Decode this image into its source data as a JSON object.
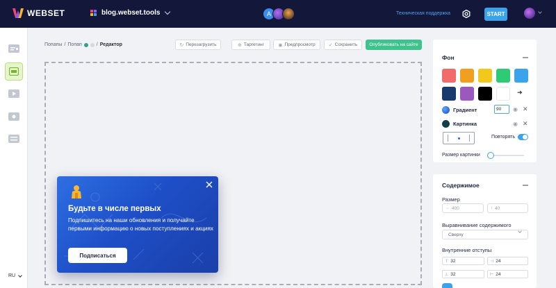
{
  "topbar": {
    "logo_text": "WEBSET",
    "site_name": "blog.webset.tools",
    "support_link": "Техническая поддержка",
    "start_label": "START",
    "avatar_initial": "A"
  },
  "sidebar": {
    "items": [
      {
        "icon": "text-block-icon"
      },
      {
        "icon": "popup-layout-icon",
        "active": true
      },
      {
        "icon": "video-icon"
      },
      {
        "icon": "image-icon"
      },
      {
        "icon": "list-icon"
      }
    ],
    "language": "RU"
  },
  "breadcrumb": {
    "items": [
      "Попапы",
      "Попап"
    ],
    "separator": "/",
    "current": "Редактор"
  },
  "toolbar": {
    "reload": "Перезагрузить",
    "targeting": "Таргетинг",
    "preview": "Предпросмотр",
    "save": "Сохранить",
    "publish": "Опубликовать на сайте"
  },
  "popup": {
    "title": "Будьте в числе первых",
    "text": "Подпишитесь на наши обновления и получайте первыми информацию о новых поступлениях и акциях",
    "button": "Подписаться"
  },
  "background_panel": {
    "title": "Фон",
    "swatches": [
      "#f26b6b",
      "#f0a020",
      "#f2c81e",
      "#2ecb74",
      "#3aa3ec",
      "#1a3a6e",
      "#9b59c0",
      "#000000",
      "#ffffff"
    ],
    "gradient_label": "Градиент",
    "gradient_angle": "90",
    "image_label": "Картинка",
    "repeat_label": "Повторять",
    "image_size_label": "Размер картинки",
    "image_size_value": 0
  },
  "content_panel": {
    "title": "Содержимое",
    "size_label": "Размер",
    "width_placeholder": "400",
    "height_placeholder": "40",
    "align_label": "Выравнивание содержимого",
    "align_value": "Сверху",
    "padding_label": "Внутренние отступы",
    "padding": [
      "32",
      "24",
      "32",
      "24"
    ]
  },
  "colors": {
    "topbar": "#13173a",
    "accent": "#3aa3ec",
    "publish": "#3fc28b"
  }
}
